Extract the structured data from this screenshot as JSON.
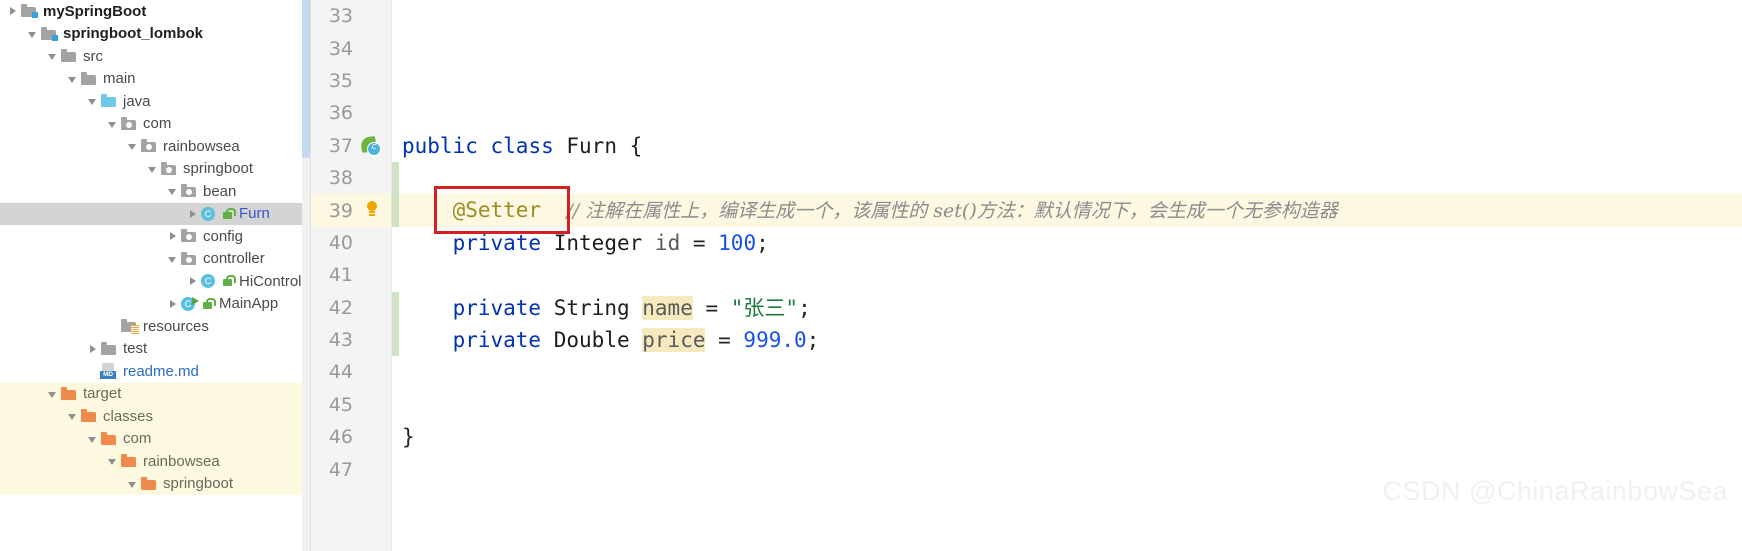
{
  "colors": {
    "selection_bg": "#d4d4d4",
    "excluded_bg": "#fdf9e0",
    "current_line_bg": "#fcf8e2",
    "gutter_bg": "#f4f4f4",
    "annotation_box": "#d42020",
    "keyword": "#0033b3",
    "string": "#1c7a3e",
    "number": "#1750eb",
    "annotation_text": "#9e8b22",
    "comment": "#8c8c8c",
    "field_highlight": "#f6e9bd",
    "folder_excluded": "#f08a4b",
    "folder_source": "#72c6e8"
  },
  "project_tree": {
    "items": [
      {
        "label": "mySpringBoot",
        "indent": 0,
        "arrow": "collapsed",
        "icon": "module-folder-icon",
        "style": "bold",
        "state": "normal"
      },
      {
        "label": "springboot_lombok",
        "indent": 1,
        "arrow": "expanded",
        "icon": "module-folder-icon",
        "style": "bold",
        "state": "normal"
      },
      {
        "label": "src",
        "indent": 2,
        "arrow": "expanded",
        "icon": "folder-icon",
        "style": "gray",
        "state": "normal"
      },
      {
        "label": "main",
        "indent": 3,
        "arrow": "expanded",
        "icon": "folder-icon",
        "style": "gray",
        "state": "normal"
      },
      {
        "label": "java",
        "indent": 4,
        "arrow": "expanded",
        "icon": "source-folder-icon",
        "style": "gray",
        "state": "normal"
      },
      {
        "label": "com",
        "indent": 5,
        "arrow": "expanded",
        "icon": "package-icon",
        "style": "gray",
        "state": "normal"
      },
      {
        "label": "rainbowsea",
        "indent": 6,
        "arrow": "expanded",
        "icon": "package-icon",
        "style": "gray",
        "state": "normal"
      },
      {
        "label": "springboot",
        "indent": 7,
        "arrow": "expanded",
        "icon": "package-icon",
        "style": "gray",
        "state": "normal"
      },
      {
        "label": "bean",
        "indent": 8,
        "arrow": "expanded",
        "icon": "package-icon",
        "style": "gray",
        "state": "normal"
      },
      {
        "label": "Furn",
        "indent": 9,
        "arrow": "collapsed",
        "icon": "java-class-icon",
        "style": "blue",
        "state": "selected",
        "lock": true
      },
      {
        "label": "config",
        "indent": 8,
        "arrow": "collapsed",
        "icon": "package-icon",
        "style": "gray",
        "state": "normal"
      },
      {
        "label": "controller",
        "indent": 8,
        "arrow": "expanded",
        "icon": "package-icon",
        "style": "gray",
        "state": "normal"
      },
      {
        "label": "HiControlle",
        "indent": 9,
        "arrow": "collapsed",
        "icon": "java-class-icon",
        "style": "gray",
        "state": "normal",
        "lock": true
      },
      {
        "label": "MainApp",
        "indent": 8,
        "arrow": "collapsed",
        "icon": "java-runnable-icon",
        "style": "gray",
        "state": "normal",
        "lock": true
      },
      {
        "label": "resources",
        "indent": 5,
        "arrow": "none",
        "icon": "resources-folder-icon",
        "style": "gray",
        "state": "normal"
      },
      {
        "label": "test",
        "indent": 4,
        "arrow": "collapsed",
        "icon": "folder-icon",
        "style": "gray",
        "state": "normal"
      },
      {
        "label": "readme.md",
        "indent": 4,
        "arrow": "none",
        "icon": "markdown-file-icon",
        "style": "mdlink",
        "state": "normal"
      },
      {
        "label": "target",
        "indent": 2,
        "arrow": "expanded",
        "icon": "excluded-folder-icon",
        "style": "exclabel",
        "state": "excluded"
      },
      {
        "label": "classes",
        "indent": 3,
        "arrow": "expanded",
        "icon": "excluded-folder-icon",
        "style": "exclabel",
        "state": "excluded"
      },
      {
        "label": "com",
        "indent": 4,
        "arrow": "expanded",
        "icon": "excluded-folder-icon",
        "style": "exclabel",
        "state": "excluded"
      },
      {
        "label": "rainbowsea",
        "indent": 5,
        "arrow": "expanded",
        "icon": "excluded-folder-icon",
        "style": "exclabel",
        "state": "excluded"
      },
      {
        "label": "springboot",
        "indent": 6,
        "arrow": "expanded",
        "icon": "excluded-folder-icon",
        "style": "exclabel",
        "state": "excluded"
      }
    ]
  },
  "editor": {
    "first_line_number": 33,
    "current_line_number": 39,
    "lines": [
      {
        "n": 33,
        "gadget": "none",
        "changed": false,
        "tokens": []
      },
      {
        "n": 34,
        "gadget": "none",
        "changed": false,
        "tokens": []
      },
      {
        "n": 35,
        "gadget": "none",
        "changed": false,
        "tokens": []
      },
      {
        "n": 36,
        "gadget": "none",
        "changed": false,
        "tokens": []
      },
      {
        "n": 37,
        "gadget": "spring-class-icon",
        "changed": false,
        "tokens": [
          {
            "t": "public",
            "c": "kw"
          },
          {
            "t": " ",
            "c": "plain"
          },
          {
            "t": "class",
            "c": "kw"
          },
          {
            "t": " ",
            "c": "plain"
          },
          {
            "t": "Furn",
            "c": "type"
          },
          {
            "t": " ",
            "c": "plain"
          },
          {
            "t": "{",
            "c": "brace"
          }
        ]
      },
      {
        "n": 38,
        "gadget": "none",
        "changed": true,
        "tokens": []
      },
      {
        "n": 39,
        "gadget": "lightbulb-icon",
        "changed": true,
        "tokens": [
          {
            "t": "    ",
            "c": "plain"
          },
          {
            "t": "@Setter",
            "c": "anno"
          },
          {
            "t": "  ",
            "c": "plain"
          },
          {
            "t": "// 注解在属性上，编译生成一个，该属性的 set()方法：默认情况下，会生成一个无参构造器",
            "c": "cmt"
          }
        ]
      },
      {
        "n": 40,
        "gadget": "none",
        "changed": false,
        "tokens": [
          {
            "t": "    ",
            "c": "plain"
          },
          {
            "t": "private",
            "c": "kw"
          },
          {
            "t": " ",
            "c": "plain"
          },
          {
            "t": "Integer",
            "c": "type"
          },
          {
            "t": " ",
            "c": "plain"
          },
          {
            "t": "id",
            "c": "ident"
          },
          {
            "t": " = ",
            "c": "plain"
          },
          {
            "t": "100",
            "c": "num"
          },
          {
            "t": ";",
            "c": "plain"
          }
        ]
      },
      {
        "n": 41,
        "gadget": "none",
        "changed": false,
        "tokens": []
      },
      {
        "n": 42,
        "gadget": "none",
        "changed": true,
        "tokens": [
          {
            "t": "    ",
            "c": "plain"
          },
          {
            "t": "private",
            "c": "kw"
          },
          {
            "t": " ",
            "c": "plain"
          },
          {
            "t": "String",
            "c": "type"
          },
          {
            "t": " ",
            "c": "plain"
          },
          {
            "t": "name",
            "c": "ident hlfield"
          },
          {
            "t": " = ",
            "c": "plain"
          },
          {
            "t": "\"张三\"",
            "c": "str"
          },
          {
            "t": ";",
            "c": "plain"
          }
        ]
      },
      {
        "n": 43,
        "gadget": "none",
        "changed": true,
        "tokens": [
          {
            "t": "    ",
            "c": "plain"
          },
          {
            "t": "private",
            "c": "kw"
          },
          {
            "t": " ",
            "c": "plain"
          },
          {
            "t": "Double",
            "c": "type"
          },
          {
            "t": " ",
            "c": "plain"
          },
          {
            "t": "price",
            "c": "ident hlfield"
          },
          {
            "t": " = ",
            "c": "plain"
          },
          {
            "t": "999.0",
            "c": "num"
          },
          {
            "t": ";",
            "c": "plain"
          }
        ]
      },
      {
        "n": 44,
        "gadget": "none",
        "changed": false,
        "tokens": []
      },
      {
        "n": 45,
        "gadget": "none",
        "changed": false,
        "tokens": []
      },
      {
        "n": 46,
        "gadget": "none",
        "changed": false,
        "tokens": [
          {
            "t": "}",
            "c": "brace"
          }
        ]
      },
      {
        "n": 47,
        "gadget": "none",
        "changed": false,
        "tokens": []
      }
    ]
  },
  "annotation": {
    "highlight_target": "@Setter //",
    "shape": "rectangle"
  },
  "watermark": {
    "text": "CSDN @ChinaRainbowSea"
  }
}
